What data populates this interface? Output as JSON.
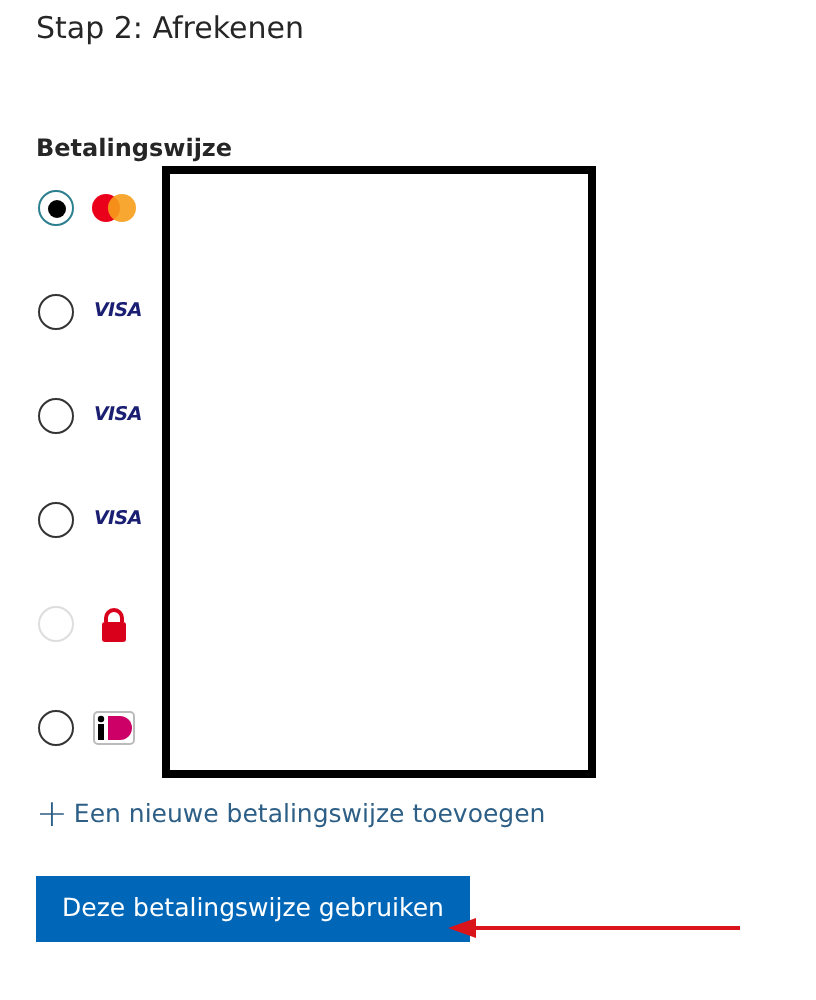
{
  "heading": "Stap 2: Afrekenen",
  "section_label": "Betalingswijze",
  "methods": [
    {
      "kind": "mastercard",
      "selected": true,
      "disabled": false
    },
    {
      "kind": "visa",
      "logo_text": "VISA",
      "selected": false,
      "disabled": false
    },
    {
      "kind": "visa",
      "logo_text": "VISA",
      "selected": false,
      "disabled": false
    },
    {
      "kind": "visa",
      "logo_text": "VISA",
      "selected": false,
      "disabled": false
    },
    {
      "kind": "lock",
      "selected": false,
      "disabled": true
    },
    {
      "kind": "ideal",
      "selected": false,
      "disabled": false
    }
  ],
  "add_link": {
    "icon": "+",
    "label": "Een nieuwe betalingswijze toevoegen"
  },
  "submit_button": "Deze betalingswijze gebruiken"
}
